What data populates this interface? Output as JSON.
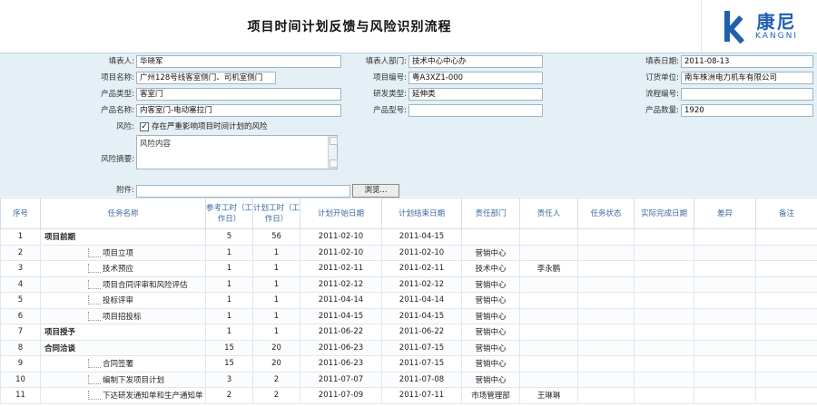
{
  "header": {
    "title": "项目时间计划反馈与风险识别流程",
    "logo_cn": "康尼",
    "logo_en": "KANGNI"
  },
  "form": {
    "applicant_label": "填表人:",
    "applicant_value": "华晓军",
    "dept_label": "填表人部门:",
    "dept_value": "技术中心中心办",
    "date_label": "填表日期:",
    "date_value": "2011-08-13",
    "project_name_label": "项目名称:",
    "project_name_value": "广州128号线客室侧门、司机室侧门",
    "project_no_label": "项目编号:",
    "project_no_value": "粤A3XZ1-000",
    "order_unit_label": "订货单位:",
    "order_unit_value": "南车株洲电力机车有限公司",
    "product_type_label": "产品类型:",
    "product_type_value": "客室门",
    "dev_type_label": "研发类型:",
    "dev_type_value": "延伸类",
    "flow_no_label": "流程编号:",
    "flow_no_value": "",
    "product_name_label": "产品名称:",
    "product_name_value": "内客室门-电动塞拉门",
    "product_model_label": "产品型号:",
    "product_model_value": "",
    "product_qty_label": "产品数量:",
    "product_qty_value": "1920",
    "risk_label": "风险:",
    "risk_checked": "✓",
    "risk_checkbox_text": "存在严重影响项目时间计划的风险",
    "risk_summary_label": "风险摘要:",
    "risk_summary_value": "风险内容",
    "attachment_label": "附件:",
    "browse_label": "浏览..."
  },
  "table": {
    "headers": [
      "序号",
      "任务名称",
      "参考工时（工作日）",
      "计划工时（工作日）",
      "计划开始日期",
      "计划结束日期",
      "责任部门",
      "责任人",
      "任务状态",
      "实际完成日期",
      "差异",
      "备注"
    ],
    "rows": [
      {
        "no": "1",
        "name": "项目前期",
        "level": "parent",
        "ref": "5",
        "plan": "56",
        "start": "2011-02-10",
        "end": "2011-04-15",
        "dept": "",
        "owner": ""
      },
      {
        "no": "2",
        "name": "项目立项",
        "level": "child",
        "ref": "1",
        "plan": "1",
        "start": "2011-02-10",
        "end": "2011-02-10",
        "dept": "营销中心",
        "owner": ""
      },
      {
        "no": "3",
        "name": "技术预应",
        "level": "child",
        "ref": "1",
        "plan": "1",
        "start": "2011-02-11",
        "end": "2011-02-11",
        "dept": "技术中心",
        "owner": "李永鹏"
      },
      {
        "no": "4",
        "name": "项目合同评审和风险评估",
        "level": "child",
        "ref": "1",
        "plan": "1",
        "start": "2011-02-12",
        "end": "2011-02-12",
        "dept": "营销中心",
        "owner": ""
      },
      {
        "no": "5",
        "name": "投标评审",
        "level": "child",
        "ref": "1",
        "plan": "1",
        "start": "2011-04-14",
        "end": "2011-04-14",
        "dept": "营销中心",
        "owner": ""
      },
      {
        "no": "6",
        "name": "项目招投标",
        "level": "child",
        "ref": "1",
        "plan": "1",
        "start": "2011-04-15",
        "end": "2011-04-15",
        "dept": "营销中心",
        "owner": ""
      },
      {
        "no": "7",
        "name": "项目授予",
        "level": "parent",
        "ref": "1",
        "plan": "1",
        "start": "2011-06-22",
        "end": "2011-06-22",
        "dept": "营销中心",
        "owner": ""
      },
      {
        "no": "8",
        "name": "合同洽谈",
        "level": "parent",
        "ref": "15",
        "plan": "20",
        "start": "2011-06-23",
        "end": "2011-07-15",
        "dept": "营销中心",
        "owner": ""
      },
      {
        "no": "9",
        "name": "合同签署",
        "level": "child",
        "ref": "15",
        "plan": "20",
        "start": "2011-06-23",
        "end": "2011-07-15",
        "dept": "营销中心",
        "owner": ""
      },
      {
        "no": "10",
        "name": "编制下发项目计划",
        "level": "child",
        "ref": "3",
        "plan": "2",
        "start": "2011-07-07",
        "end": "2011-07-08",
        "dept": "营销中心",
        "owner": ""
      },
      {
        "no": "11",
        "name": "下达研发通知单和生产通知单",
        "level": "child",
        "ref": "2",
        "plan": "2",
        "start": "2011-07-09",
        "end": "2011-07-11",
        "dept": "市场管理部",
        "owner": "王琳琳"
      }
    ]
  }
}
